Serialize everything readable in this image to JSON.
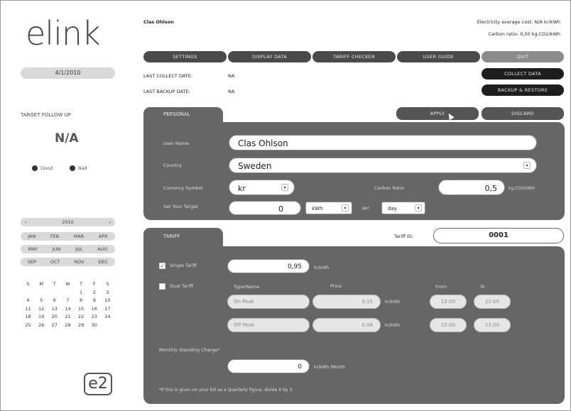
{
  "brand": {
    "logo": "elink",
    "badge": "e2"
  },
  "sidebar": {
    "date": "4/1/2010",
    "target_title": "TARGET FOLLOW UP",
    "target_value": "N/A",
    "legend_good": "Good",
    "legend_bad": "Bad",
    "calendar": {
      "prev": "‹",
      "year": "2010",
      "next": "›",
      "months": [
        [
          "JAN",
          "FEB",
          "MAR",
          "APR"
        ],
        [
          "MAY",
          "JUN",
          "JUL",
          "AUG"
        ],
        [
          "SEP",
          "OCT",
          "NOV",
          "DEC"
        ]
      ],
      "weekdays": [
        "S",
        "M",
        "T",
        "W",
        "T",
        "F",
        "S"
      ],
      "weeks": [
        [
          "",
          "",
          "",
          "",
          "1",
          "2",
          "3"
        ],
        [
          "4",
          "5",
          "6",
          "7",
          "8",
          "9",
          "10"
        ],
        [
          "11",
          "12",
          "13",
          "14",
          "15",
          "16",
          "17"
        ],
        [
          "18",
          "19",
          "20",
          "21",
          "22",
          "23",
          "24"
        ],
        [
          "25",
          "26",
          "27",
          "28",
          "29",
          "30",
          ""
        ]
      ]
    }
  },
  "header": {
    "user": "Clas Ohlson",
    "avg_cost": "Electricity average cost: N/A kr/kWh",
    "carbon_ratio": "Carbon ratio: 0,50 kg.CO2/kWh",
    "last_collect_label": "LAST COLLECT DATE:",
    "last_collect_value": "NA",
    "last_backup_label": "LAST BACKUP DATE:",
    "last_backup_value": "NA"
  },
  "nav": {
    "settings": "SETTINGS",
    "display_data": "DISPLAY DATA",
    "tariff_checker": "TARIFF CHECKER",
    "user_guide": "USER GUIDE",
    "quit": "QUIT"
  },
  "actions": {
    "collect": "COLLECT DATA",
    "backup": "BACKUP & RESTORE",
    "apply": "APPLY",
    "discard": "DISCARD"
  },
  "personal": {
    "tab": "PERSONAL",
    "user_name_label": "User Name",
    "user_name": "Clas Ohlson",
    "country_label": "Country",
    "country": "Sweden",
    "currency_label": "Currency Symbol",
    "currency": "kr",
    "carbon_label": "Carbon Ratio",
    "carbon_value": "0,5",
    "carbon_unit": "kg.CO2/kWh",
    "target_label": "Set Your Target",
    "target_value": "0",
    "target_unit": "kWh",
    "per_label": "per",
    "period": "day"
  },
  "tariff": {
    "tab": "TARIFF",
    "tariff_id_label": "Tariff ID.",
    "tariff_id": "0001",
    "single_label": "Single Tariff",
    "single_value": "0,95",
    "single_unit": "kr/kWh",
    "dual_label": "Dual Tariff",
    "col_type": "Type/Name",
    "col_price": "Price",
    "col_from": "From",
    "col_to": "To",
    "rows": [
      {
        "name": "On Peak",
        "price": "0,15",
        "unit": "kr/kWh",
        "from": "12:00",
        "to": "22:00"
      },
      {
        "name": "Off Peak",
        "price": "0,08",
        "unit": "kr/kWh",
        "from": "22:00",
        "to": "12:00"
      }
    ],
    "standing_label": "Monthly Standing Charge*",
    "standing_value": "0",
    "standing_unit": "kr/kWh /Month",
    "footnote": "*If this is given on your bill as a Quarterly figure, divide it by 3."
  },
  "colors": {
    "panel": "#666666",
    "nav": "#4a4a4a",
    "dark_button": "#1e1e1e"
  }
}
